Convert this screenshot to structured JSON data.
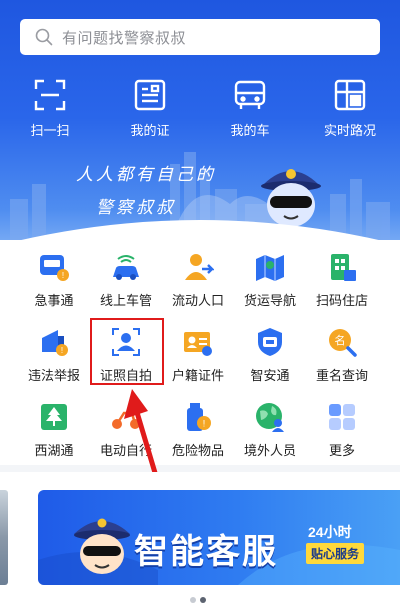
{
  "search": {
    "placeholder": "有问题找警察叔叔"
  },
  "quick_actions": [
    {
      "label": "扫一扫",
      "icon": "scan-icon"
    },
    {
      "label": "我的证",
      "icon": "id-card-icon"
    },
    {
      "label": "我的车",
      "icon": "car-front-icon"
    },
    {
      "label": "实时路况",
      "icon": "traffic-map-icon"
    }
  ],
  "slogan": {
    "line1": "人人都有自己的",
    "line2": "警察叔叔"
  },
  "services": [
    {
      "label": "急事通",
      "icon": "urgent-car-icon"
    },
    {
      "label": "线上车管",
      "icon": "online-car-icon"
    },
    {
      "label": "流动人口",
      "icon": "person-move-icon"
    },
    {
      "label": "货运导航",
      "icon": "freight-map-icon"
    },
    {
      "label": "扫码住店",
      "icon": "hotel-scan-icon"
    },
    {
      "label": "违法举报",
      "icon": "report-icon"
    },
    {
      "label": "证照自拍",
      "icon": "selfie-id-icon"
    },
    {
      "label": "户籍证件",
      "icon": "household-card-icon"
    },
    {
      "label": "智安通",
      "icon": "smart-security-icon"
    },
    {
      "label": "重名查询",
      "icon": "name-search-icon"
    },
    {
      "label": "西湖通",
      "icon": "west-lake-icon"
    },
    {
      "label": "电动自行",
      "icon": "e-bike-icon"
    },
    {
      "label": "危险物品",
      "icon": "hazard-icon"
    },
    {
      "label": "境外人员",
      "icon": "foreigner-icon"
    },
    {
      "label": "更多",
      "icon": "more-grid-icon"
    }
  ],
  "banner": {
    "title": "智能客服",
    "hours": "24小时",
    "tag": "贴心服务"
  },
  "colors": {
    "primary": "#2a66ea",
    "highlight": "#e01b1b"
  }
}
